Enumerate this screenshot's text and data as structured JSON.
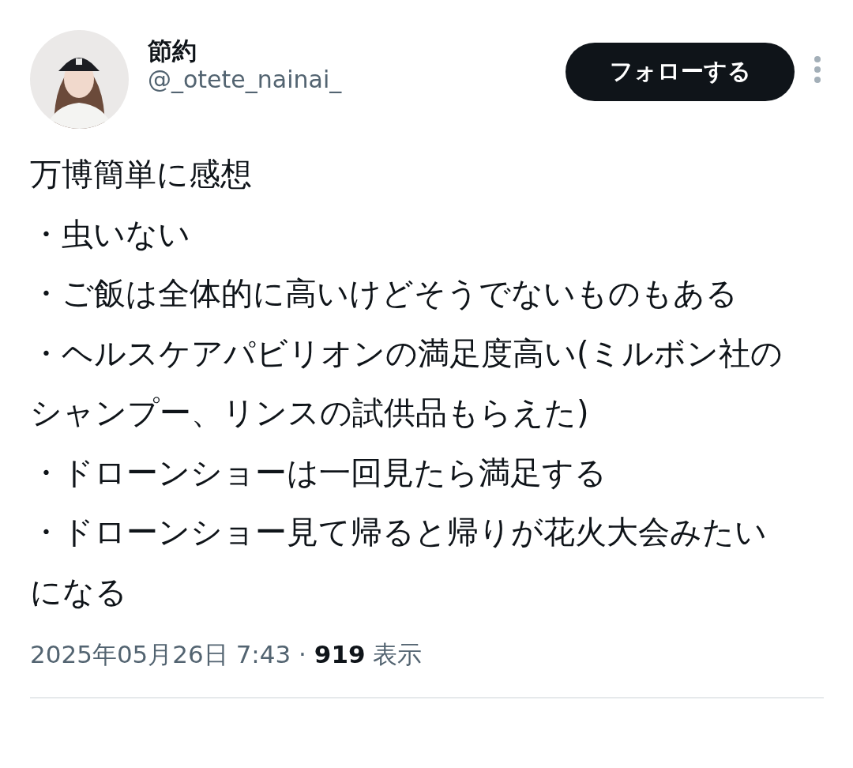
{
  "author": {
    "name": "節約",
    "handle": "@_otete_nainai_"
  },
  "follow_button": {
    "label": "フォローする"
  },
  "body_lines": [
    "万博簡単に感想",
    "・虫いない",
    "・ご飯は全体的に高いけどそうでないものもある",
    "・ヘルスケアパビリオンの満足度高い(ミルボン社のシャンプー、リンスの試供品もらえた)",
    "・ドローンショーは一回見たら満足する",
    "・ドローンショー見て帰ると帰りが花火大会みたいになる"
  ],
  "meta": "2025年05月26日 7:43 · **919** 表示"
}
